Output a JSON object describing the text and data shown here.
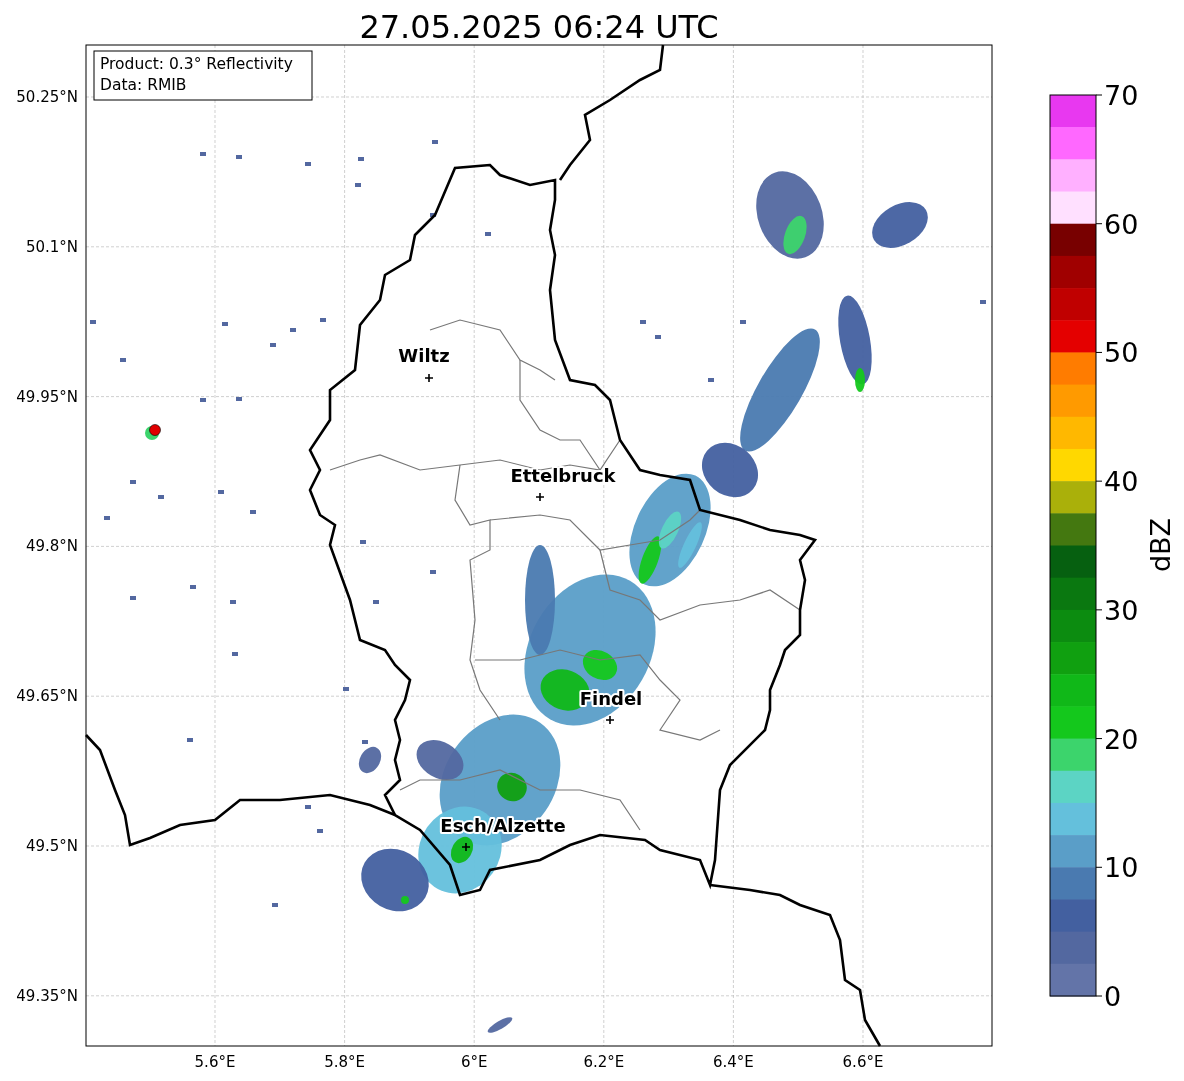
{
  "title": "27.05.2025 06:24 UTC",
  "info_box": [
    "Product: 0.3° Reflectivity",
    "Data: RMIB"
  ],
  "x_ticks": [
    "5.6°E",
    "5.8°E",
    "6°E",
    "6.2°E",
    "6.4°E",
    "6.6°E"
  ],
  "y_ticks": [
    "50.25°N",
    "50.1°N",
    "49.95°N",
    "49.8°N",
    "49.65°N",
    "49.5°N",
    "49.35°N"
  ],
  "cities": [
    {
      "name": "Wiltz"
    },
    {
      "name": "Ettelbruck"
    },
    {
      "name": "Findel"
    },
    {
      "name": "Esch/Alzette"
    }
  ],
  "colorbar": {
    "label": "dBZ",
    "ticks": [
      "70",
      "60",
      "50",
      "40",
      "30",
      "20",
      "10",
      "0"
    ],
    "bins": [
      {
        "color": "#e838f0"
      },
      {
        "color": "#ff68ff"
      },
      {
        "color": "#ffb0ff"
      },
      {
        "color": "#ffe0ff"
      },
      {
        "color": "#780000"
      },
      {
        "color": "#a00000"
      },
      {
        "color": "#c00000"
      },
      {
        "color": "#e40000"
      },
      {
        "color": "#ff7c00"
      },
      {
        "color": "#ff9a00"
      },
      {
        "color": "#ffb800"
      },
      {
        "color": "#ffd800"
      },
      {
        "color": "#aab00a"
      },
      {
        "color": "#447810"
      },
      {
        "color": "#066010"
      },
      {
        "color": "#0a7810"
      },
      {
        "color": "#0c8c10"
      },
      {
        "color": "#10a010"
      },
      {
        "color": "#10b818"
      },
      {
        "color": "#14c81c"
      },
      {
        "color": "#3cd46c"
      },
      {
        "color": "#5cd4c4"
      },
      {
        "color": "#64c0dc"
      },
      {
        "color": "#5a9ec8"
      },
      {
        "color": "#4a7ab0"
      },
      {
        "color": "#4360a0"
      },
      {
        "color": "#5368a0"
      },
      {
        "color": "#6374a8"
      }
    ]
  }
}
